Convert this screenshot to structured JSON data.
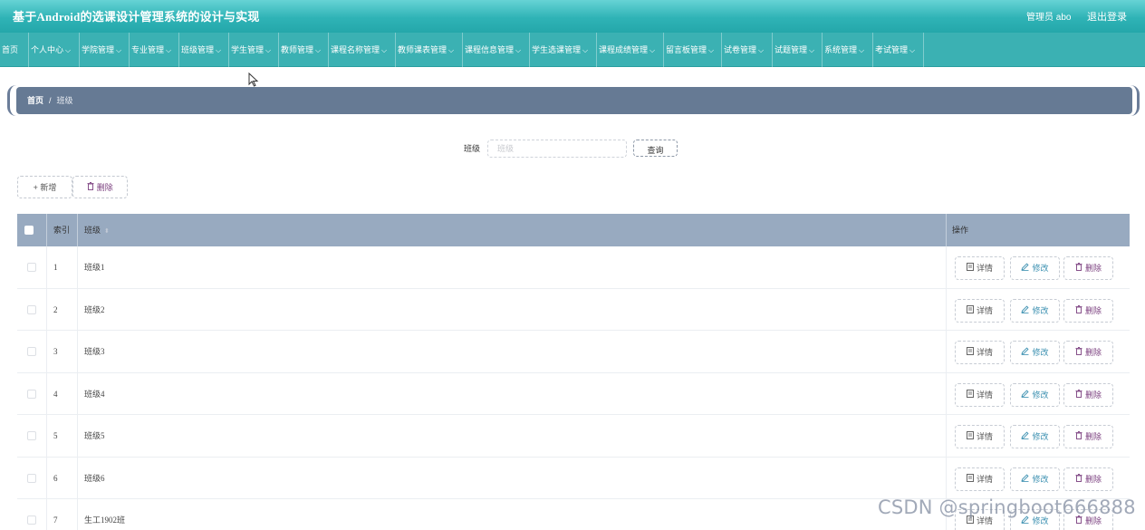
{
  "header": {
    "app_title": "基于Android的选课设计管理系统的设计与实现",
    "admin_label": "管理员 abo",
    "logout_label": "退出登录"
  },
  "nav": {
    "items": [
      {
        "label": "首页",
        "dropdown": false
      },
      {
        "label": "个人中心",
        "dropdown": true
      },
      {
        "label": "学院管理",
        "dropdown": true
      },
      {
        "label": "专业管理",
        "dropdown": true
      },
      {
        "label": "班级管理",
        "dropdown": true
      },
      {
        "label": "学生管理",
        "dropdown": true
      },
      {
        "label": "教师管理",
        "dropdown": true
      },
      {
        "label": "课程名称管理",
        "dropdown": true
      },
      {
        "label": "教师课表管理",
        "dropdown": true
      },
      {
        "label": "课程信息管理",
        "dropdown": true
      },
      {
        "label": "学生选课管理",
        "dropdown": true
      },
      {
        "label": "课程成绩管理",
        "dropdown": true
      },
      {
        "label": "留言板管理",
        "dropdown": true
      },
      {
        "label": "试卷管理",
        "dropdown": true
      },
      {
        "label": "试题管理",
        "dropdown": true
      },
      {
        "label": "系统管理",
        "dropdown": true
      },
      {
        "label": "考试管理",
        "dropdown": true
      }
    ],
    "chevron": "⌵"
  },
  "breadcrumb": {
    "home": "首页",
    "separator": "/",
    "current": "班级"
  },
  "search": {
    "label": "班级",
    "placeholder": "班级",
    "value": "",
    "button_label": "查询"
  },
  "toolbar": {
    "add_label": "新增",
    "add_icon": "+",
    "delete_label": "删除",
    "delete_icon": "🗑"
  },
  "table": {
    "columns": {
      "index": "索引",
      "class": "班级",
      "ops": "操作"
    },
    "rows": [
      {
        "index": "1",
        "class": "班级1"
      },
      {
        "index": "2",
        "class": "班级2"
      },
      {
        "index": "3",
        "class": "班级3"
      },
      {
        "index": "4",
        "class": "班级4"
      },
      {
        "index": "5",
        "class": "班级5"
      },
      {
        "index": "6",
        "class": "班级6"
      },
      {
        "index": "7",
        "class": "生工1902班"
      }
    ],
    "actions": {
      "detail": "详情",
      "edit": "修改",
      "delete": "删除"
    }
  },
  "watermark": "CSDN @springboot666888",
  "colors": {
    "topbar": "#2fb3b6",
    "navbar": "#3bb1b3",
    "breadcrumb": "#667a94",
    "table_header": "#98aac0",
    "edit": "#3a8fb0",
    "delete": "#7a3e7e"
  }
}
